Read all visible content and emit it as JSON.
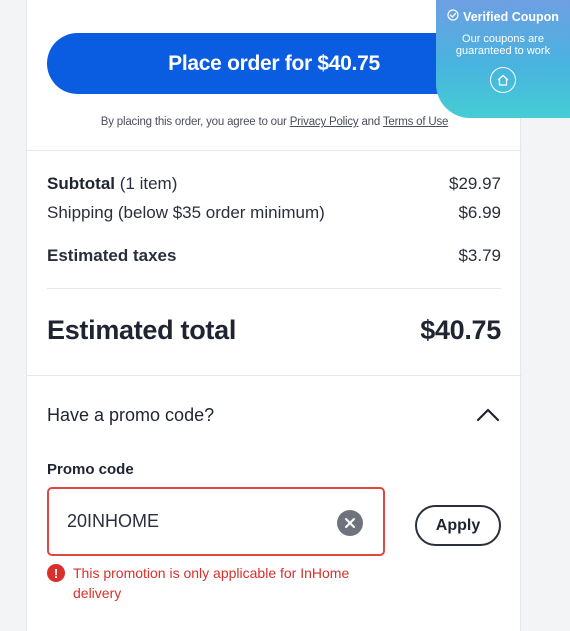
{
  "checkout": {
    "place_order_label": "Place order for $40.75",
    "legal": {
      "prefix": "By placing this order, you agree to our",
      "privacy_link": "Privacy Policy",
      "and": "and",
      "terms_link": "Terms of Use"
    }
  },
  "summary": {
    "subtotal_label": "Subtotal",
    "subtotal_count": "(1 item)",
    "subtotal_value": "$29.97",
    "shipping_label": "Shipping (below $35 order minimum)",
    "shipping_value": "$6.99",
    "taxes_label": "Estimated taxes",
    "taxes_value": "$3.79",
    "total_label": "Estimated total",
    "total_value": "$40.75"
  },
  "promo": {
    "question": "Have a promo code?",
    "field_label": "Promo code",
    "value": "20INHOME",
    "apply_label": "Apply",
    "error": "This promotion is only applicable for InHome delivery",
    "error_icon": "!"
  },
  "coupon_overlay": {
    "title": "Verified Coupon",
    "desc_line1": "Our coupons are",
    "desc_line2": "guaranteed to work",
    "icon": "home-icon"
  },
  "colors": {
    "primary": "#0a5de0",
    "error": "#d9302b",
    "overlay_top": "#6e9fe3",
    "overlay_bottom": "#45cdd4"
  }
}
